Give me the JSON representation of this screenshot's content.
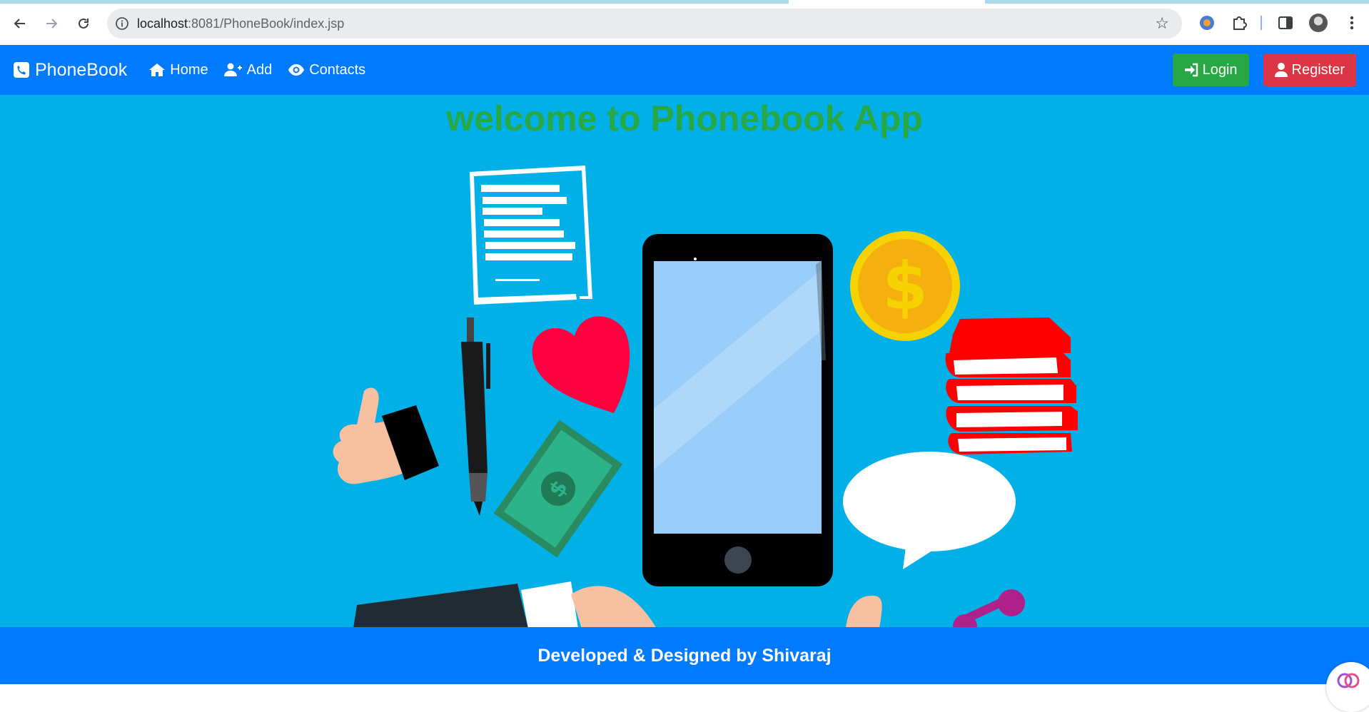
{
  "browser": {
    "url_host": "localhost",
    "url_path": ":8081/PhoneBook/index.jsp",
    "icons": {
      "back": "arrow-left-icon",
      "forward": "arrow-right-icon",
      "reload": "reload-icon",
      "site_info": "info-icon",
      "bookmark": "star-icon",
      "extensions": "puzzle-icon",
      "side_panel": "side-panel-icon",
      "profile": "avatar-icon",
      "menu": "kebab-menu-icon"
    }
  },
  "navbar": {
    "brand": "PhoneBook",
    "links": [
      {
        "label": "Home",
        "icon": "home-icon"
      },
      {
        "label": "Add",
        "icon": "user-plus-icon"
      },
      {
        "label": "Contacts",
        "icon": "eye-icon"
      }
    ],
    "login_label": "Login",
    "register_label": "Register",
    "colors": {
      "bar": "#007bff",
      "login": "#28a745",
      "register": "#dc3545"
    }
  },
  "hero": {
    "title": "welcome to Phonebook App",
    "title_color": "#28a745",
    "background": "#00b0e6"
  },
  "footer": {
    "text": "Developed & Designed by Shivaraj"
  }
}
